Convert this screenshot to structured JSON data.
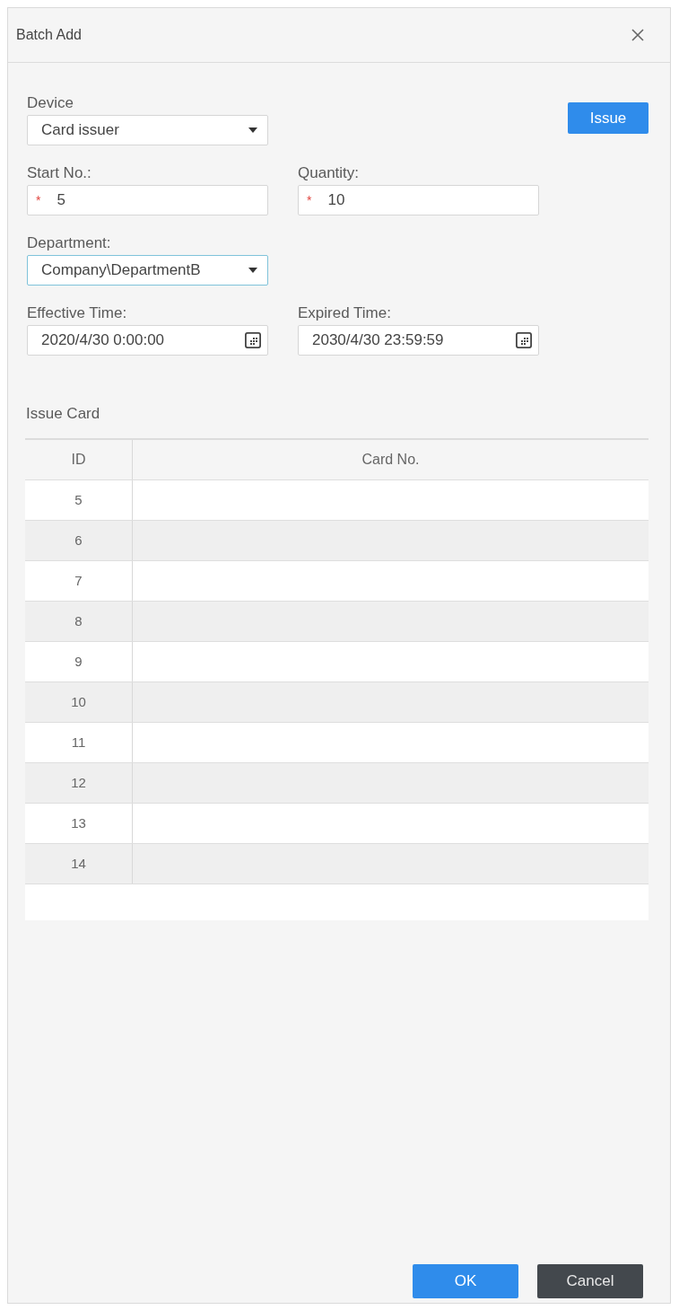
{
  "dialog": {
    "title": "Batch Add"
  },
  "form": {
    "issue_button": "Issue",
    "rows": [
      [
        {
          "kind": "select",
          "label": "Device",
          "value": "Card issuer",
          "focused": false
        }
      ],
      [
        {
          "kind": "text",
          "label": "Start No.:",
          "required_mark": "*",
          "value": "5",
          "focused": false
        },
        {
          "kind": "text",
          "label": "Quantity:",
          "required_mark": "*",
          "value": "10",
          "focused": false
        }
      ],
      [
        {
          "kind": "select",
          "label": "Department:",
          "value": "Company\\DepartmentB",
          "focused": true
        }
      ],
      [
        {
          "kind": "datetime",
          "label": "Effective Time:",
          "value": "2020/4/30 0:00:00",
          "focused": false
        },
        {
          "kind": "datetime",
          "label": "Expired Time:",
          "value": "2030/4/30 23:59:59",
          "focused": false
        }
      ]
    ]
  },
  "table": {
    "title": "Issue Card",
    "columns": [
      "ID",
      "Card No."
    ],
    "rows": [
      {
        "id": "5"
      },
      {
        "id": "6"
      },
      {
        "id": "7"
      },
      {
        "id": "8"
      },
      {
        "id": "9"
      },
      {
        "id": "10"
      },
      {
        "id": "11"
      },
      {
        "id": "12"
      },
      {
        "id": "13"
      },
      {
        "id": "14"
      }
    ]
  },
  "footer": {
    "buttons": [
      {
        "label": "OK",
        "kind": "primary"
      },
      {
        "label": "Cancel",
        "kind": "secondary"
      }
    ]
  }
}
